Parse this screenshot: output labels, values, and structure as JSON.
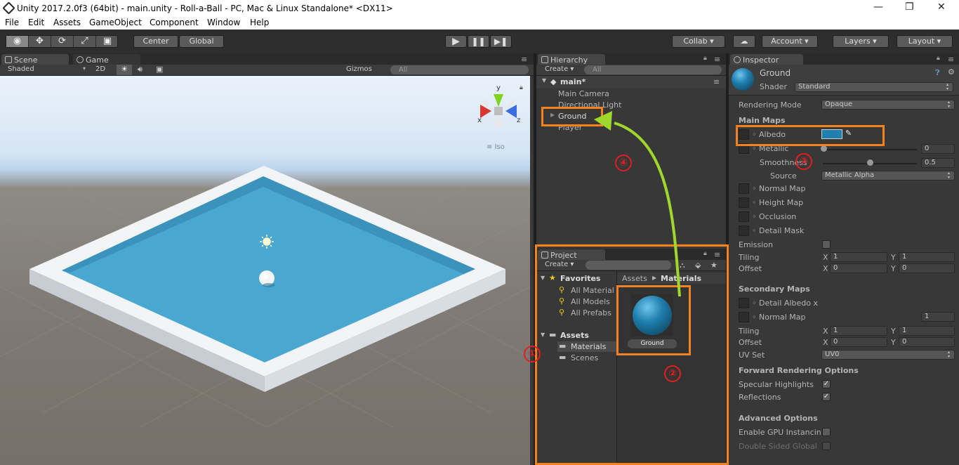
{
  "window": {
    "title": "Unity 2017.2.0f3 (64bit) - main.unity - Roll-a-Ball - PC, Mac & Linux Standalone* <DX11>"
  },
  "menu": [
    "File",
    "Edit",
    "Assets",
    "GameObject",
    "Component",
    "Window",
    "Help"
  ],
  "toolbar": {
    "pivot": "Center",
    "space": "Global",
    "collab": "Collab",
    "account": "Account",
    "layers": "Layers",
    "layout": "Layout"
  },
  "scene": {
    "tab_scene": "Scene",
    "tab_game": "Game",
    "shading": "Shaded",
    "mode2d": "2D",
    "gizmos": "Gizmos",
    "search_placeholder": "All",
    "iso": "Iso",
    "gizmo_x": "x",
    "gizmo_y": "y",
    "gizmo_z": "z"
  },
  "hierarchy": {
    "tab": "Hierarchy",
    "create": "Create",
    "search_placeholder": "All",
    "scene": "main*",
    "items": [
      "Main Camera",
      "Directional Light",
      "Ground",
      "Player"
    ]
  },
  "project": {
    "tab": "Project",
    "create": "Create",
    "favorites": "Favorites",
    "fav_items": [
      "All Material",
      "All Models",
      "All Prefabs"
    ],
    "assets": "Assets",
    "folders": [
      "Materials",
      "Scenes"
    ],
    "path_root": "Assets",
    "path_child": "Materials",
    "asset_name": "Ground"
  },
  "inspector": {
    "tab": "Inspector",
    "name": "Ground",
    "shader_label": "Shader",
    "shader": "Standard",
    "rendering_mode_label": "Rendering Mode",
    "rendering_mode": "Opaque",
    "main_maps": "Main Maps",
    "albedo": "Albedo",
    "metallic": "Metallic",
    "metallic_val": "0",
    "smoothness": "Smoothness",
    "smoothness_val": "0.5",
    "source": "Source",
    "source_val": "Metallic Alpha",
    "normal_map": "Normal Map",
    "height_map": "Height Map",
    "occlusion": "Occlusion",
    "detail_mask": "Detail Mask",
    "emission": "Emission",
    "tiling": "Tiling",
    "offset": "Offset",
    "x": "X",
    "y": "Y",
    "tiling_x": "1",
    "tiling_y": "1",
    "offset_x": "0",
    "offset_y": "0",
    "secondary_maps": "Secondary Maps",
    "detail_albedo": "Detail Albedo x",
    "normal_map2": "Normal Map",
    "normal_scale": "1",
    "tiling2_x": "1",
    "tiling2_y": "1",
    "offset2_x": "0",
    "offset2_y": "0",
    "uv_set": "UV Set",
    "uv_val": "UV0",
    "forward": "Forward Rendering Options",
    "specular": "Specular Highlights",
    "reflections": "Reflections",
    "advanced": "Advanced Options",
    "gpu": "Enable GPU Instancin",
    "double_sided": "Double Sided Global"
  },
  "annotations": {
    "n1": "①",
    "n2": "②",
    "n3": "③",
    "n4": "④"
  },
  "colors": {
    "accent": "#f48221",
    "albedo": "#1f7fae",
    "arrow": "#9fd82a"
  }
}
